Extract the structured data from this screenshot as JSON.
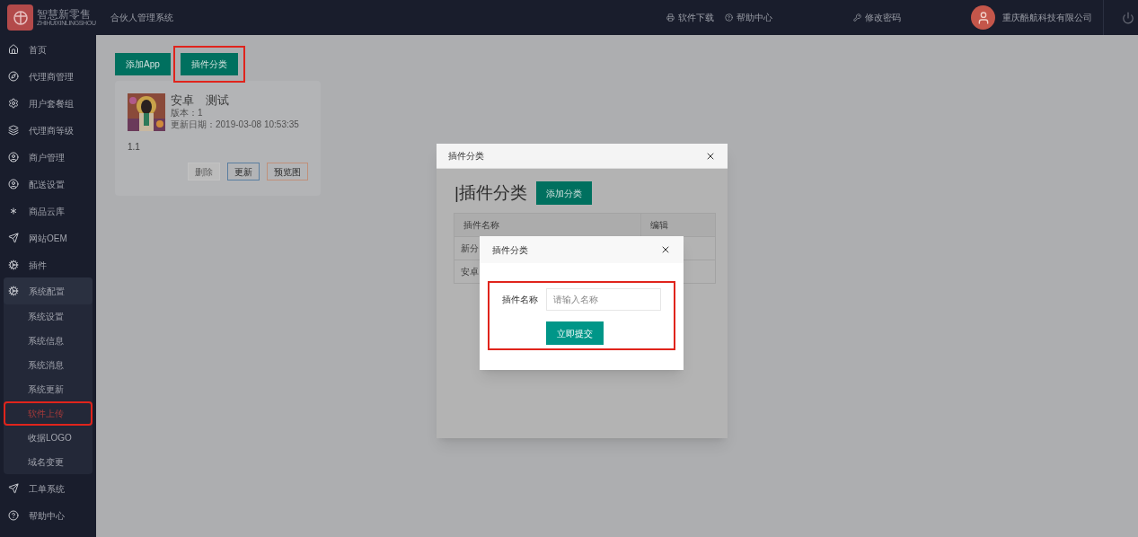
{
  "header": {
    "logo_title": "智慧新零售",
    "logo_subtitle": "ZHIHUIXINLINGSHOU",
    "system_name": "合伙人管理系统",
    "links": [
      {
        "label": "软件下载",
        "kind": "download"
      },
      {
        "label": "帮助中心",
        "kind": "help"
      },
      {
        "label": "修改密码",
        "kind": "password"
      }
    ],
    "user": "重庆酷航科技有限公司"
  },
  "sidebar": {
    "items": [
      {
        "label": "首页",
        "expanded": false
      },
      {
        "label": "代理商管理",
        "expanded": false
      },
      {
        "label": "用户套餐组",
        "expanded": false
      },
      {
        "label": "代理商等级",
        "expanded": false
      },
      {
        "label": "商户管理",
        "expanded": false
      },
      {
        "label": "配送设置",
        "expanded": false
      },
      {
        "label": "商品云库",
        "expanded": false
      },
      {
        "label": "网站OEM",
        "expanded": false
      },
      {
        "label": "插件",
        "expanded": false
      },
      {
        "label": "系统配置",
        "expanded": true,
        "children": [
          {
            "label": "系统设置",
            "selected": false
          },
          {
            "label": "系统信息",
            "selected": false
          },
          {
            "label": "系统消息",
            "selected": false
          },
          {
            "label": "系统更新",
            "selected": false
          },
          {
            "label": "软件上传",
            "selected": true
          },
          {
            "label": "收据LOGO",
            "selected": false
          },
          {
            "label": "域名变更",
            "selected": false
          }
        ]
      },
      {
        "label": "工单系统",
        "expanded": false
      },
      {
        "label": "帮助中心",
        "expanded": false
      }
    ]
  },
  "toolbar": [
    "添加App",
    "插件分类"
  ],
  "app_card": {
    "title": "安卓　测试",
    "version": "版本：1",
    "updated": "更新日期：2019-03-08 10:53:35",
    "description": "1.1",
    "actions": [
      {
        "label": "删除",
        "kind": "disabled"
      },
      {
        "label": "更新",
        "kind": "primary"
      },
      {
        "label": "预览图",
        "kind": "warm"
      }
    ]
  },
  "category_dialog": {
    "title": "插件分类",
    "heading": "|插件分类",
    "add_button": "添加分类",
    "table": {
      "columns": [
        "插件名称",
        "编辑"
      ],
      "rows": [
        [
          "新分"
        ],
        [
          "安卓"
        ]
      ]
    }
  },
  "add_dialog": {
    "title": "插件分类",
    "field_label": "插件名称",
    "placeholder": "请输入名称",
    "submit": "立即提交"
  }
}
